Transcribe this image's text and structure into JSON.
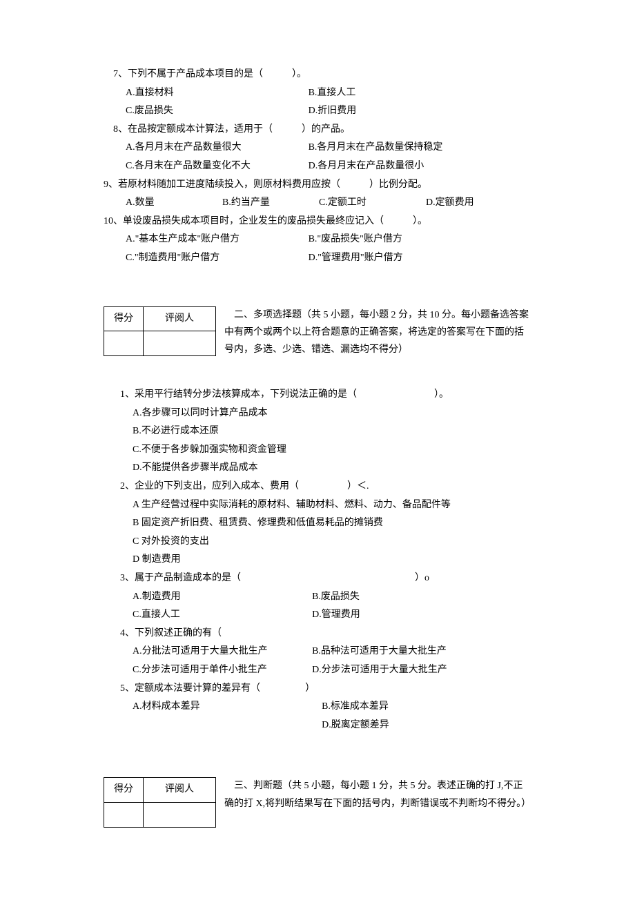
{
  "section1": {
    "q7": {
      "stem": "7、下列不属于产品成本项目的是（　　　）。",
      "a": "A.直接材料",
      "b": "B.直接人工",
      "c": "C.废品损失",
      "d": "D.折旧费用"
    },
    "q8": {
      "stem": "8、在品按定额成本计算法，适用于（　　　）的产品。",
      "a": "A.各月月末在产品数量很大",
      "b": "B.各月月末在产品数量保持稳定",
      "c": "C.各月末在产品数量变化不大",
      "d": "D.各月月末在产品数量很小"
    },
    "q9": {
      "stem": "9、若原材料随加工进度陆续投入，则原材料费用应按（　　　）比例分配。",
      "a": "A.数量",
      "b": "B.约当产量",
      "c": "C.定额工时",
      "d": "D.定额费用"
    },
    "q10": {
      "stem": "10、单设废品损失成本项目时，企业发生的废品损失最终应记入（　　　）。",
      "a": "A.\"基本生产成本\"账户借方",
      "b": "B.\"废品损失\"账户借方",
      "c": "C.\"制造费用\"账户借方",
      "d": "D.\"管理费用\"账户借方"
    }
  },
  "score": {
    "score_label": "得分",
    "reviewer_label": "评阅人"
  },
  "section2": {
    "header": "　二、多项选择题（共 5 小题，每小题 2 分，共 10 分。每小题备选答案中有两个或两个以上符合题意的正确答案，将选定的答案写在下面的括号内，多选、少选、错选、漏选均不得分）",
    "q1": {
      "stem": "1、采用平行结转分步法核算成本，下列说法正确的是（　　　　　　　　）。",
      "a": "A.各步骤可以同时计算产品成本",
      "b": "B.不必进行成本还原",
      "c": "C.不便于各步躲加强实物和资金管理",
      "d": "D.不能提供各步骤半成品成本"
    },
    "q2": {
      "stem": "2、企业的下列支出，应列入成本、费用（　　　　　）＜.",
      "a": "A 生产经营过程中实际消耗的原材料、辅助材料、燃料、动力、备品配件等",
      "b": "B 固定资产折旧费、租赁费、修理费和低值易耗品的摊销费",
      "c": "C 对外投资的支出",
      "d": "D 制造费用"
    },
    "q3": {
      "stem": "3、属于产品制造成本的是（　　　　　　　　　　　　　　　　　　）o",
      "a": "A.制造费用",
      "b": "B.废品损失",
      "c": "C.直接人工",
      "d": "D.管理费用"
    },
    "q4": {
      "stem": "4、下列叙述正确的有（",
      "a": "A.分批法可适用于大量大批生产",
      "b": "B.品种法可适用于大量大批生产",
      "c": "C.分步法可适用于单件小批生产",
      "d": "D.分步法可适用于大量大批生产"
    },
    "q5": {
      "stem": "5、定额成本法要计算的差异有（",
      "closer": "）",
      "a": "A.材料成本差异",
      "b": "B.标准成本差异",
      "d": "D.脱离定额差异"
    }
  },
  "section3": {
    "header": "　三、判断题（共 5 小题，每小题 1 分，共 5 分。表述正确的打 J,不正确的打 X,将判断结果写在下面的括号内，判断错误或不判断均不得分。）"
  }
}
